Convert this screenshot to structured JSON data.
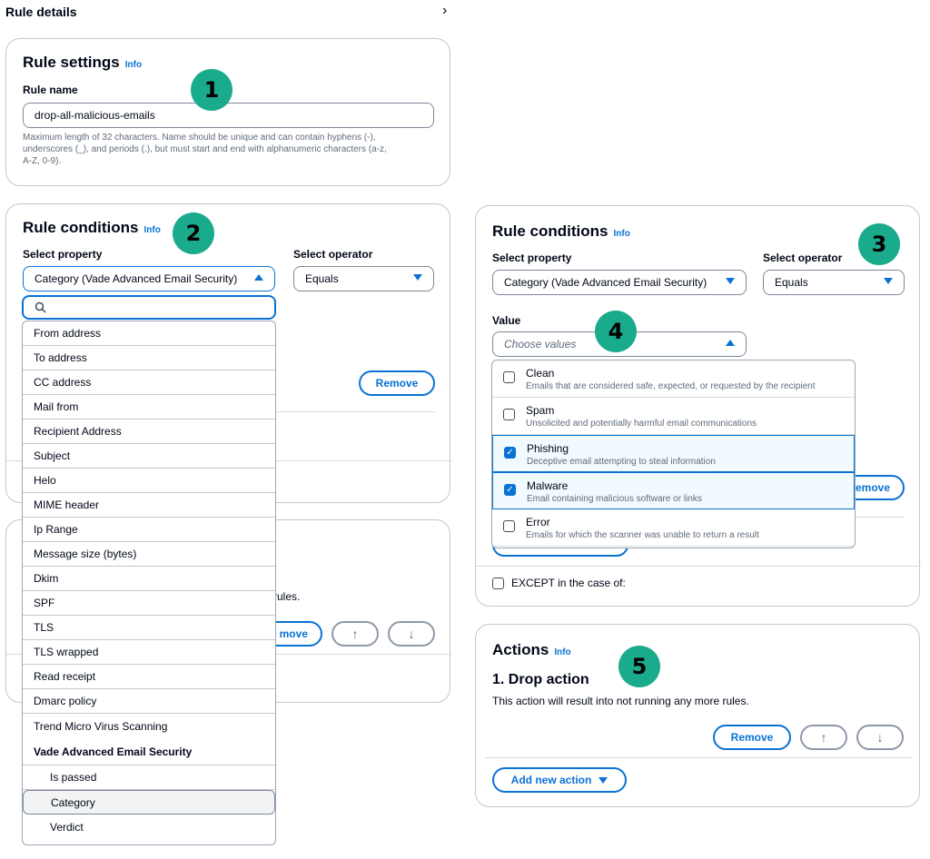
{
  "header": {
    "title": "Rule details",
    "chevron_icon": "chevron-right-icon"
  },
  "badges": [
    "1",
    "2",
    "3",
    "4",
    "5"
  ],
  "rule_settings": {
    "title": "Rule settings",
    "info": "Info",
    "name_label": "Rule name",
    "name_value": "drop-all-malicious-emails",
    "help_line1": "Maximum length of 32 characters. Name should be unique and can contain hyphens (-),",
    "help_line2": "underscores (_), and periods (.), but must start and end with alphanumeric characters (a-z,",
    "help_line3": "A-Z, 0-9)."
  },
  "left_conditions": {
    "title": "Rule conditions",
    "info": "Info",
    "property_label": "Select property",
    "property_value": "Category (Vade Advanced Email Security)",
    "operator_label": "Select operator",
    "operator_value": "Equals",
    "remove_label": "Remove",
    "remove_partial": "move",
    "partial_text": "rules.",
    "search_placeholder": "",
    "properties": [
      "From address",
      "To address",
      "CC address",
      "Mail from",
      "Recipient Address",
      "Subject",
      "Helo",
      "MIME header",
      "Ip Range",
      "Message size (bytes)",
      "Dkim",
      "SPF",
      "TLS",
      "TLS wrapped",
      "Read receipt",
      "Dmarc policy",
      "Trend Micro Virus Scanning"
    ],
    "group_label": "Vade Advanced Email Security",
    "group_items": [
      "Is passed",
      "Category",
      "Verdict"
    ]
  },
  "right_conditions": {
    "title": "Rule conditions",
    "info": "Info",
    "property_label": "Select property",
    "property_value": "Category (Vade Advanced Email Security)",
    "operator_label": "Select operator",
    "operator_value": "Equals",
    "value_label": "Value",
    "value_placeholder": "Choose values",
    "options": [
      {
        "title": "Clean",
        "desc": "Emails that are considered safe, expected, or requested by the recipient",
        "checked": false
      },
      {
        "title": "Spam",
        "desc": "Unsolicited and potentially harmful email communications",
        "checked": false
      },
      {
        "title": "Phishing",
        "desc": "Deceptive email attempting to steal information",
        "checked": true
      },
      {
        "title": "Malware",
        "desc": "Email containing malicious software or links",
        "checked": true
      },
      {
        "title": "Error",
        "desc": "Emails for which the scanner was unable to return a result",
        "checked": false
      }
    ],
    "remove_partial": "emove",
    "except_label": "EXCEPT in the case of:"
  },
  "actions": {
    "title": "Actions",
    "info": "Info",
    "action_title": "1. Drop action",
    "action_desc": "This action will result into not running any more rules.",
    "remove_label": "Remove",
    "add_label": "Add new action"
  },
  "colors": {
    "accent": "#0972d3",
    "badge": "#1aaa8c",
    "border": "#c6c6cd"
  }
}
